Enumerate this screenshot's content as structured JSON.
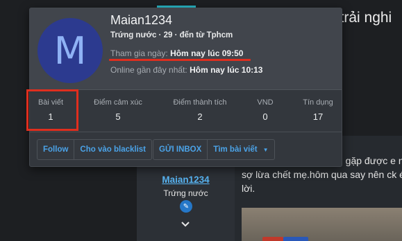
{
  "background": {
    "headline": "n trải nghi",
    "post_lines": [
      "h gặp được e n",
      "sợ lừa chết mẹ.hôm qua say nên ck é",
      "lời."
    ],
    "sidebar_username": "Maian1234",
    "sidebar_rank": "Trứng nước"
  },
  "card": {
    "avatar_letter": "M",
    "name": "Maian1234",
    "userline": "Trứng nước · 29 · đến từ Tphcm",
    "join_label": "Tham gia ngày:",
    "join_value": "Hôm nay lúc 09:50",
    "online_label": "Online gần đây nhất:",
    "online_value": "Hôm nay lúc 10:13",
    "stats": [
      {
        "label": "Bài viết",
        "value": "1"
      },
      {
        "label": "Điểm cảm xúc",
        "value": "5"
      },
      {
        "label": "Điểm thành tích",
        "value": "2"
      },
      {
        "label": "VND",
        "value": "0"
      },
      {
        "label": "Tín dụng",
        "value": "17"
      }
    ],
    "buttons": {
      "follow": "Follow",
      "blacklist": "Cho vào blacklist",
      "inbox": "GỬI INBOX",
      "find_posts": "Tìm bài viết"
    }
  },
  "colors": {
    "highlight": "#e02e1e",
    "link": "#4ba3e8",
    "avatar_bg": "#2c3a8f"
  }
}
